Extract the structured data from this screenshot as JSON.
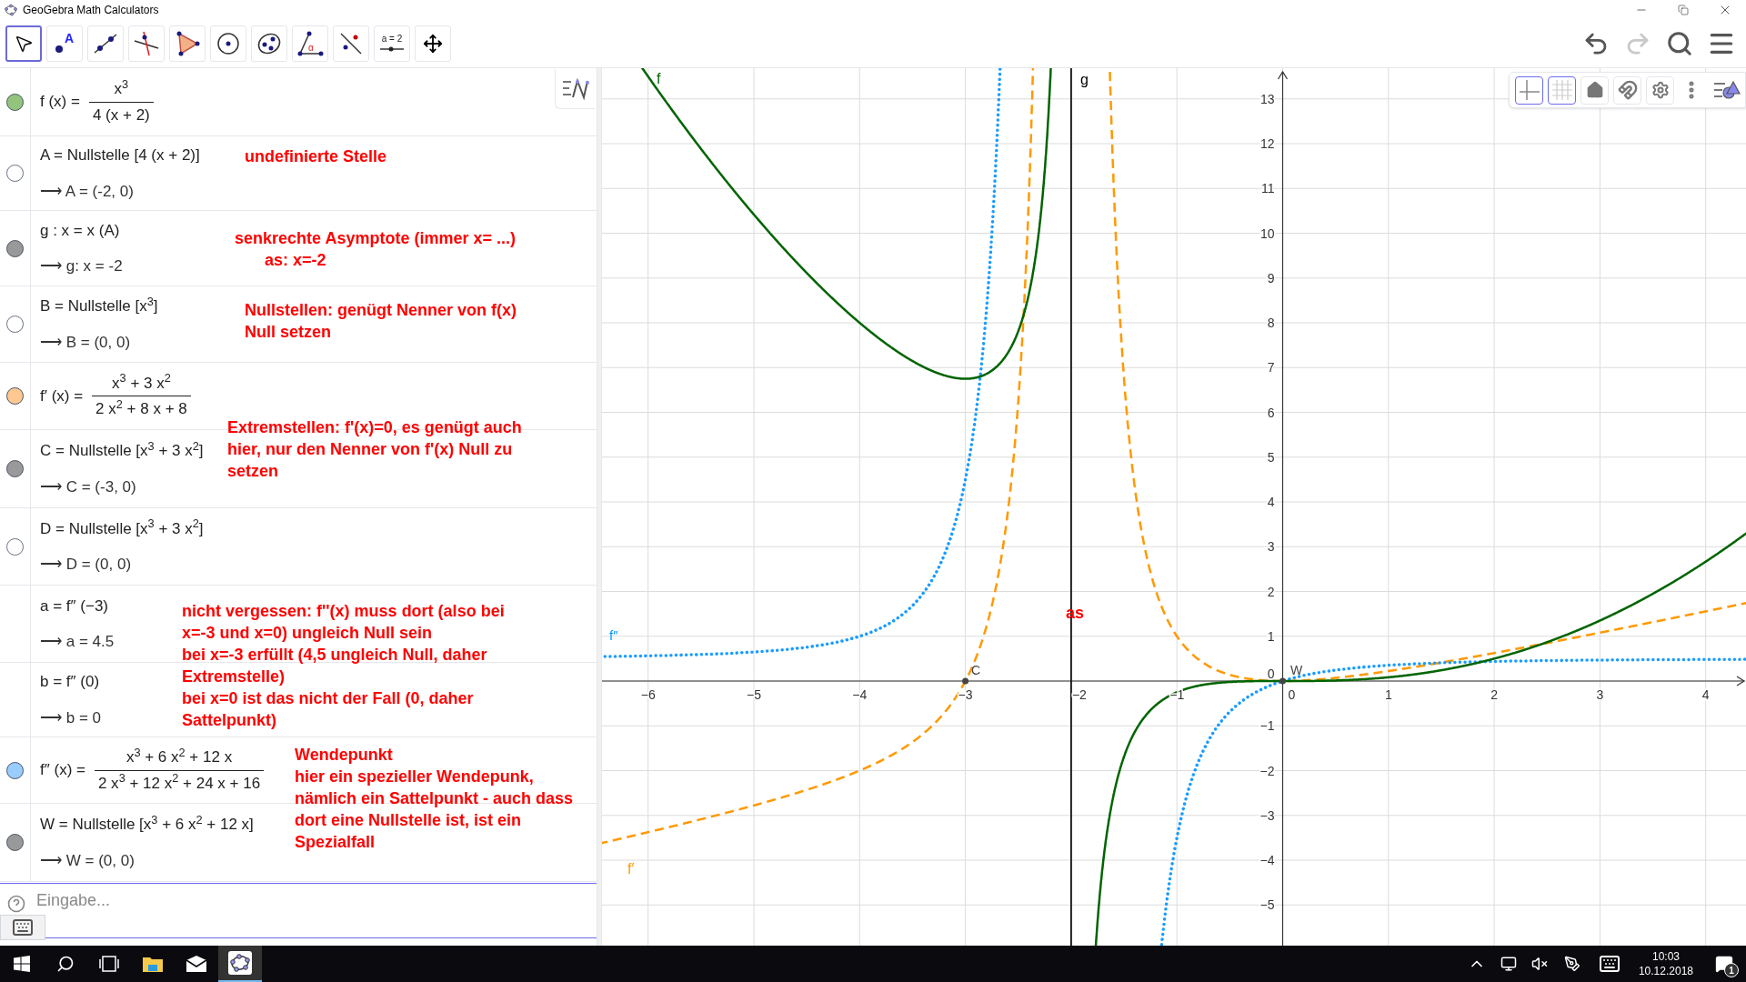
{
  "window": {
    "title": "GeoGebra Math Calculators"
  },
  "toolbar": {
    "tools": [
      {
        "kind": "move",
        "selected": true
      },
      {
        "kind": "point",
        "selected": false,
        "label": "A"
      },
      {
        "kind": "line",
        "selected": false
      },
      {
        "kind": "perpendicular",
        "selected": false
      },
      {
        "kind": "polygon",
        "selected": false
      },
      {
        "kind": "circle",
        "selected": false
      },
      {
        "kind": "conic",
        "selected": false
      },
      {
        "kind": "angle",
        "selected": false,
        "label": "α"
      },
      {
        "kind": "reflect",
        "selected": false
      },
      {
        "kind": "slider",
        "selected": false,
        "label": "a = 2"
      },
      {
        "kind": "pan",
        "selected": false
      }
    ],
    "actions": [
      {
        "kind": "undo",
        "disabled": false
      },
      {
        "kind": "redo",
        "disabled": true
      },
      {
        "kind": "search",
        "disabled": false
      },
      {
        "kind": "menu",
        "disabled": false
      }
    ]
  },
  "algebra": {
    "rows": [
      {
        "kind": "fraction",
        "dot": {
          "visible": true,
          "color": "#93c47d"
        },
        "lhs": "f (x) =",
        "numerator": "x$^{3}$",
        "denominator": "4 (x + 2)"
      },
      {
        "kind": "command",
        "dot": {
          "visible": false
        },
        "definition": "A = Nullstelle [4 (x + 2)]",
        "result": "⟶ A = (-2, 0)",
        "note": [
          {
            "text": "undefinierte Stelle",
            "indented": false
          }
        ]
      },
      {
        "kind": "command",
        "dot": {
          "visible": true,
          "color": "#999999"
        },
        "definition": "g : x = x (A)",
        "result": "⟶ g: x = -2",
        "note": [
          {
            "text": "senkrechte Asymptote (immer x= ...)",
            "indented": false
          },
          {
            "text": "as: x=-2",
            "indented": true
          }
        ]
      },
      {
        "kind": "command",
        "dot": {
          "visible": false
        },
        "definition": "B = Nullstelle [x$^{3}$]",
        "result": "⟶ B = (0, 0)",
        "note": [
          {
            "text": "Nullstellen: genügt Nenner von f(x)",
            "indented": false
          },
          {
            "text": "Null setzen",
            "indented": false
          }
        ]
      },
      {
        "kind": "fraction",
        "dot": {
          "visible": true,
          "color": "#ffc890"
        },
        "lhs": "f′ (x) =",
        "numerator": "x$^{3}$ + 3 x$^{2}$",
        "denominator": "2 x$^{2}$ + 8 x + 8",
        "note": [
          {
            "text": "Extremstellen: f'(x)=0, es genügt auch",
            "indented": false
          },
          {
            "text": "hier, nur den Nenner von f'(x) Null zu",
            "indented": false
          },
          {
            "text": "setzen",
            "indented": false
          }
        ]
      },
      {
        "kind": "command",
        "dot": {
          "visible": true,
          "color": "#999999"
        },
        "definition": "C = Nullstelle [x$^{3}$ + 3 x$^{2}$]",
        "result": "⟶ C = (-3, 0)"
      },
      {
        "kind": "command",
        "dot": {
          "visible": false
        },
        "definition": "D = Nullstelle [x$^{3}$ + 3 x$^{2}$]",
        "result": "⟶ D = (0, 0)"
      },
      {
        "kind": "command",
        "definition": "a = f″ (−3)",
        "result": "⟶ a = 4.5",
        "note": [
          {
            "text": "nicht vergessen: f''(x) muss dort (also bei",
            "indented": false
          },
          {
            "text": "x=-3 und x=0) ungleich Null sein",
            "indented": false
          },
          {
            "text": "bei x=-3 erfüllt  (4,5 ungleich Null, daher",
            "indented": false
          },
          {
            "text": "Extremstelle)",
            "indented": false
          },
          {
            "text": "bei x=0 ist das nicht der Fall (0, daher",
            "indented": false
          },
          {
            "text": "Sattelpunkt)",
            "indented": false
          }
        ]
      },
      {
        "kind": "command",
        "definition": "b = f″ (0)",
        "result": "⟶ b = 0"
      },
      {
        "kind": "fraction",
        "dot": {
          "visible": true,
          "color": "#99ccff"
        },
        "lhs": "f″ (x) =",
        "numerator": "x$^{3}$ + 6 x$^{2}$ + 12 x",
        "denominator": "2 x$^{3}$ + 12 x$^{2}$ + 24 x + 16",
        "note": [
          {
            "text": "Wendepunkt",
            "indented": false
          },
          {
            "text": "hier ein spezieller Wendepunk,",
            "indented": false
          },
          {
            "text": "nämlich ein Sattelpunkt - auch dass",
            "indented": false
          },
          {
            "text": "dort eine Nullstelle ist, ist ein",
            "indented": false
          },
          {
            "text": "Spezialfall",
            "indented": false
          }
        ]
      },
      {
        "kind": "command",
        "dot": {
          "visible": true,
          "color": "#999999"
        },
        "definition": "W = Nullstelle [x$^{3}$ + 6 x$^{2}$ + 12 x]",
        "result": "⟶ W = (0, 0)"
      }
    ],
    "input": {
      "placeholder": "Eingabe..."
    }
  },
  "graph": {
    "style_bar": [
      {
        "kind": "axes",
        "selected": true
      },
      {
        "kind": "grid",
        "selected": true
      },
      {
        "kind": "home",
        "selected": false
      },
      {
        "kind": "magnet",
        "selected": false
      },
      {
        "kind": "settings",
        "selected": false
      }
    ],
    "x_ticks": [
      "−6",
      "−5",
      "−4",
      "−3",
      "−2",
      "−1",
      "0",
      "1",
      "2",
      "3",
      "4"
    ],
    "y_ticks": [
      "13",
      "12",
      "11",
      "10",
      "9",
      "8",
      "7",
      "6",
      "5",
      "4",
      "3",
      "2",
      "1",
      "0",
      "−1",
      "−2",
      "−3",
      "−4",
      "−5"
    ],
    "labels": [
      {
        "kind": "curve",
        "text": "f",
        "color": "#006400"
      },
      {
        "kind": "curve",
        "text": "g",
        "color": "#000000"
      },
      {
        "kind": "curve",
        "text": "f″",
        "color": "#0099ff"
      },
      {
        "kind": "curve",
        "text": "f′",
        "color": "#ff9900"
      },
      {
        "kind": "point",
        "text": "C",
        "color": "#444444"
      },
      {
        "kind": "point",
        "text": "W",
        "color": "#444444"
      },
      {
        "kind": "text",
        "text": "as",
        "color": "#ff0000"
      }
    ]
  },
  "taskbar": {
    "time": "10:03",
    "date": "10.12.2018",
    "notifications": "1"
  }
}
